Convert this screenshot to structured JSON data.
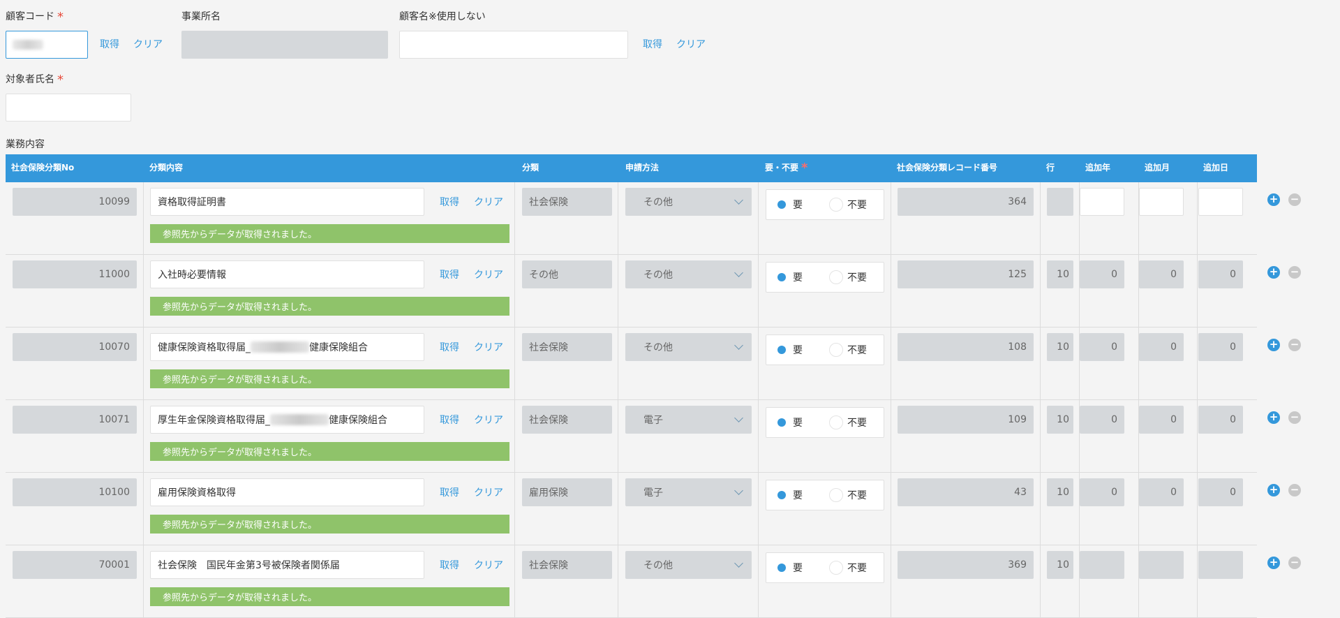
{
  "form": {
    "customer_code_label": "顧客コード",
    "office_name_label": "事業所名",
    "customer_name_label": "顧客名※使用しない",
    "target_name_label": "対象者氏名",
    "business_label": "業務内容",
    "get_label": "取得",
    "clear_label": "クリア",
    "required_mark": "*"
  },
  "table": {
    "headers": {
      "no": "社会保険分類No",
      "content": "分類内容",
      "category": "分類",
      "method": "申請方法",
      "need": "要・不要",
      "record": "社会保険分類レコード番号",
      "line": "行",
      "year": "追加年",
      "month": "追加月",
      "day": "追加日"
    },
    "message": "参照先からデータが取得されました。",
    "need_label": "要",
    "no_need_label": "不要",
    "rows": [
      {
        "no": "10099",
        "content_pre": "資格取得証明書",
        "content_post": "",
        "blur": false,
        "category": "社会保険",
        "method": "その他",
        "record": "364",
        "line": "",
        "year": "",
        "month": "",
        "day": "",
        "editable_date": true
      },
      {
        "no": "11000",
        "content_pre": "入社時必要情報",
        "content_post": "",
        "blur": false,
        "category": "その他",
        "method": "その他",
        "record": "125",
        "line": "10",
        "year": "0",
        "month": "0",
        "day": "0",
        "editable_date": false
      },
      {
        "no": "10070",
        "content_pre": "健康保険資格取得届_",
        "content_post": "健康保険組合",
        "blur": true,
        "category": "社会保険",
        "method": "その他",
        "record": "108",
        "line": "10",
        "year": "0",
        "month": "0",
        "day": "0",
        "editable_date": false
      },
      {
        "no": "10071",
        "content_pre": "厚生年金保険資格取得届_",
        "content_post": "健康保険組合",
        "blur": true,
        "category": "社会保険",
        "method": "電子",
        "record": "109",
        "line": "10",
        "year": "0",
        "month": "0",
        "day": "0",
        "editable_date": false
      },
      {
        "no": "10100",
        "content_pre": "雇用保険資格取得",
        "content_post": "",
        "blur": false,
        "category": "雇用保険",
        "method": "電子",
        "record": "43",
        "line": "10",
        "year": "0",
        "month": "0",
        "day": "0",
        "editable_date": false
      },
      {
        "no": "70001",
        "content_pre": "社会保険　国民年金第3号被保険者関係届",
        "content_post": "",
        "blur": false,
        "category": "社会保険",
        "method": "その他",
        "record": "369",
        "line": "10",
        "year": "",
        "month": "",
        "day": "",
        "editable_date": false
      }
    ]
  }
}
